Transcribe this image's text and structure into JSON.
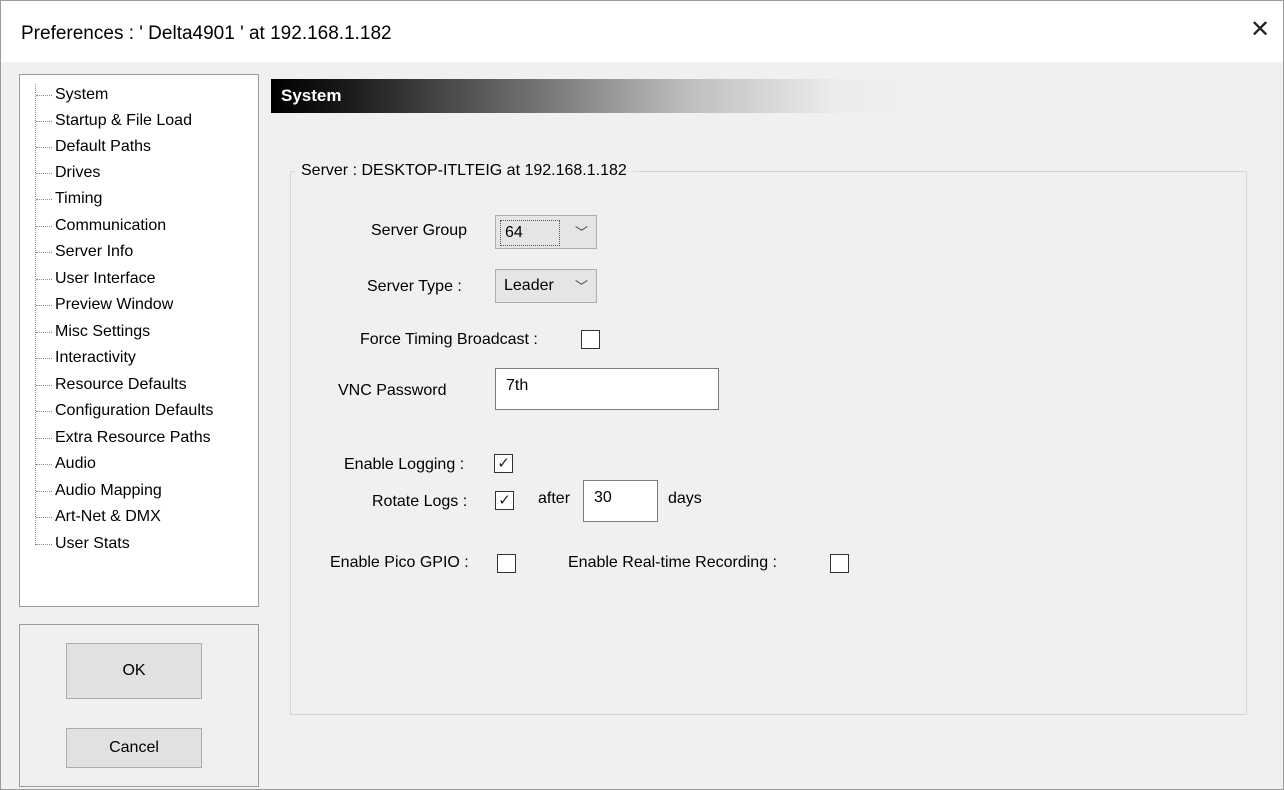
{
  "window": {
    "title": "Preferences  :  ' Delta4901 ' at 192.168.1.182",
    "close_glyph": "✕"
  },
  "tree": {
    "items": [
      "System",
      "Startup & File Load",
      "Default Paths",
      "Drives",
      "Timing",
      "Communication",
      "Server Info",
      "User Interface",
      "Preview Window",
      "Misc Settings",
      "Interactivity",
      "Resource Defaults",
      "Configuration Defaults",
      "Extra Resource Paths",
      "Audio",
      "Audio Mapping",
      "Art-Net & DMX",
      "User Stats"
    ],
    "selected": "System"
  },
  "buttons": {
    "ok": "OK",
    "cancel": "Cancel"
  },
  "header": {
    "title": "System"
  },
  "group": {
    "legend": "Server : DESKTOP-ITLTEIG  at  192.168.1.182"
  },
  "form": {
    "server_group_label": "Server Group",
    "server_group_value": "64",
    "server_type_label": "Server Type :",
    "server_type_value": "Leader",
    "force_timing_label": "Force Timing Broadcast :",
    "vnc_label": "VNC Password",
    "vnc_value": "7th",
    "enable_logging_label": "Enable Logging :",
    "rotate_logs_label": "Rotate Logs :",
    "after_label": "after",
    "days_value": "30",
    "days_label": "days",
    "pico_gpio_label": "Enable Pico GPIO :",
    "realtime_label": "Enable Real-time Recording :",
    "check_glyph": "✓",
    "chevron_glyph": "﹀"
  },
  "checkboxes": {
    "force_timing_broadcast": false,
    "enable_logging": true,
    "rotate_logs": true,
    "enable_pico_gpio": false,
    "enable_realtime_recording": false
  }
}
